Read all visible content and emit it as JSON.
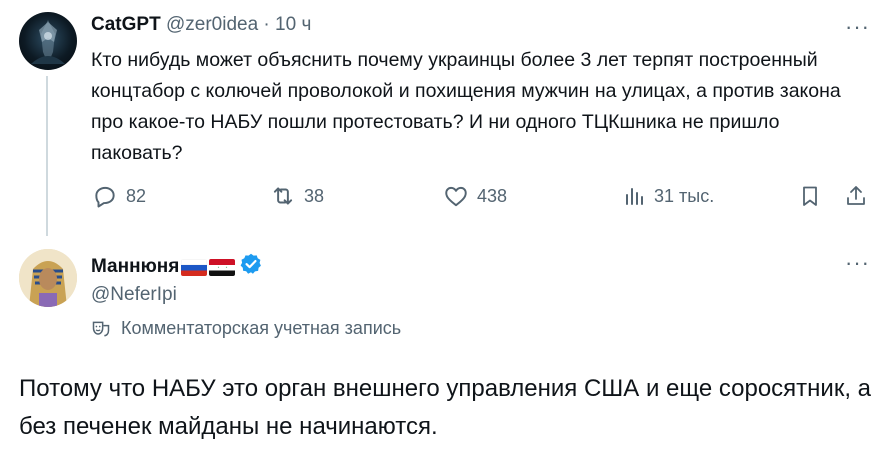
{
  "tweet": {
    "author_name": "CatGPT",
    "author_handle": "@zer0idea",
    "separator": "·",
    "time": "10 ч",
    "text": "Кто нибудь может объяснить почему украинцы более 3 лет терпят построенный концтабор с колючей проволокой и похищения мужчин на улицах, а против закона про какое-то НАБУ пошли протестовать? И ни одного ТЦКшника не пришло паковать?",
    "replies": "82",
    "reposts": "38",
    "likes": "438",
    "views": "31 тыс.",
    "more": "···",
    "avatar_icon": "dark-fantasy-avatar"
  },
  "reply": {
    "author_name": "Маннюня",
    "author_handle": "@NeferIpi",
    "account_label": "Комментаторская учетная запись",
    "text": "Потому что НАБУ это орган внешнего управления США и еще соросятник, а без печенек майданы не начинаются.",
    "more": "···",
    "flags": [
      "russia-flag",
      "syria-flag"
    ],
    "verified_color": "#1d9bf0",
    "avatar_icon": "pharaoh-avatar"
  },
  "colors": {
    "text": "#0f1419",
    "muted": "#536471",
    "accent": "#1d9bf0",
    "thread_line": "#cfd9de"
  }
}
